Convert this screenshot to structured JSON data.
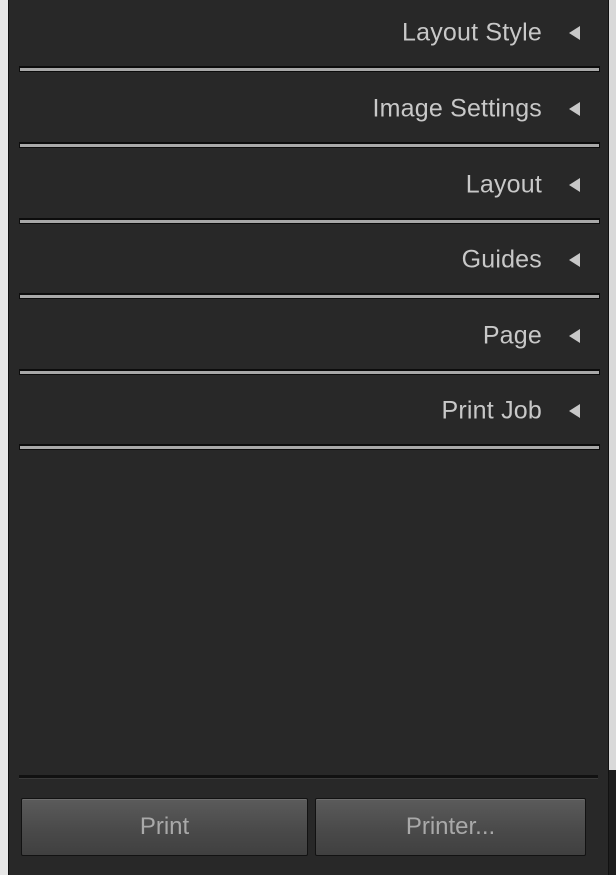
{
  "panel": {
    "sections": [
      {
        "label": "Layout Style",
        "icon": "collapse-arrow-icon"
      },
      {
        "label": "Image Settings",
        "icon": "collapse-arrow-icon"
      },
      {
        "label": "Layout",
        "icon": "collapse-arrow-icon"
      },
      {
        "label": "Guides",
        "icon": "collapse-arrow-icon"
      },
      {
        "label": "Page",
        "icon": "collapse-arrow-icon"
      },
      {
        "label": "Print Job",
        "icon": "collapse-arrow-icon"
      }
    ]
  },
  "footer": {
    "print_label": "Print",
    "printer_label": "Printer..."
  },
  "colors": {
    "panel_bg": "#282828",
    "text": "#c8c8c8",
    "button_text": "#a9a9a9",
    "button_bg": "#4a4a4a"
  }
}
